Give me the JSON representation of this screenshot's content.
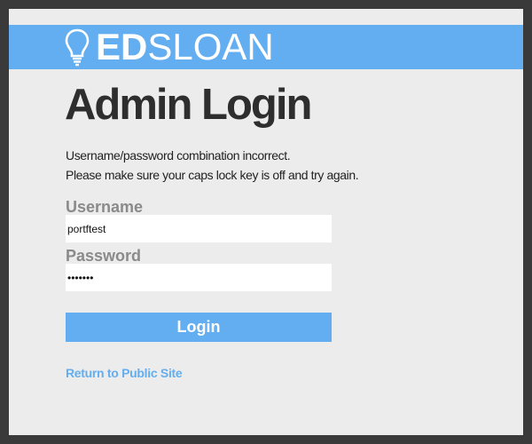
{
  "brand": {
    "logo_bold": "ED",
    "logo_light": "SLOAN",
    "accent_color": "#63aef0"
  },
  "page": {
    "title": "Admin Login",
    "error_line1": "Username/password combination incorrect.",
    "error_line2": "Please make sure your caps lock key is off and try again."
  },
  "form": {
    "username_label": "Username",
    "username_value": "portftest",
    "password_label": "Password",
    "password_value": "•••••••",
    "submit_label": "Login"
  },
  "footer": {
    "return_link": "Return to Public Site"
  }
}
